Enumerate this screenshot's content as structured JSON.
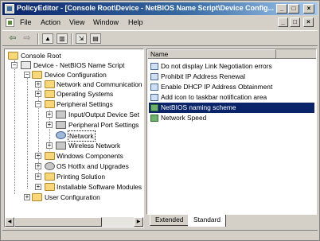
{
  "window": {
    "title": "PolicyEditor - [Console Root\\Device - NetBIOS Name Script\\Device Config..."
  },
  "titlebar_buttons": [
    "_",
    "□",
    "×"
  ],
  "menubar": {
    "items": [
      {
        "label": "File",
        "accel": "F"
      },
      {
        "label": "Action",
        "accel": "A"
      },
      {
        "label": "View",
        "accel": "V"
      },
      {
        "label": "Window",
        "accel": "W"
      },
      {
        "label": "Help",
        "accel": "H"
      }
    ],
    "mdi_buttons": [
      "_",
      "□",
      "×"
    ]
  },
  "toolbar": {
    "back_glyph": "⇦",
    "forward_glyph": "⇨",
    "up_glyph": "▲",
    "tree_glyph": "▥",
    "export_glyph": "⇲",
    "properties_glyph": "▤"
  },
  "tree": {
    "nodes": [
      {
        "label": "Console Root",
        "expander": ""
      },
      {
        "label": "Device - NetBIOS Name Script",
        "expander": "−"
      },
      {
        "label": "Device Configuration",
        "expander": "−"
      },
      {
        "label": "Network and Communication",
        "expander": "+"
      },
      {
        "label": "Operating Systems",
        "expander": "+"
      },
      {
        "label": "Peripheral  Settings",
        "expander": "−"
      },
      {
        "label": "Input/Output Device Set",
        "expander": "+"
      },
      {
        "label": "Peripheral Port Settings",
        "expander": "+"
      },
      {
        "label": "Network",
        "expander": ""
      },
      {
        "label": "Wireless Network",
        "expander": "+"
      },
      {
        "label": "Windows Components",
        "expander": "+"
      },
      {
        "label": "OS Hotfix and  Upgrades",
        "expander": "+"
      },
      {
        "label": "Printing Solution",
        "expander": "+"
      },
      {
        "label": "Installable Software Modules",
        "expander": "+"
      },
      {
        "label": "User Configuration",
        "expander": "+"
      }
    ]
  },
  "list": {
    "column_header": "Name",
    "items": [
      {
        "label": "Do not display Link Negotiation errors"
      },
      {
        "label": "Prohibit IP Address Renewal"
      },
      {
        "label": "Enable DHCP IP Address Obtainment"
      },
      {
        "label": "Add icon to taskbar notification area"
      },
      {
        "label": "NetBIOS naming scheme"
      },
      {
        "label": "Network Speed"
      }
    ],
    "selected_index": 4
  },
  "scrollbar": {
    "left_arrow": "◀",
    "right_arrow": "▶"
  },
  "tabs": [
    {
      "label": "Extended"
    },
    {
      "label": "Standard"
    }
  ],
  "active_tab_index": 1,
  "colors": {
    "selection": "#0a246a",
    "titlebar_start": "#0a246a",
    "folder": "#f7d77a"
  }
}
